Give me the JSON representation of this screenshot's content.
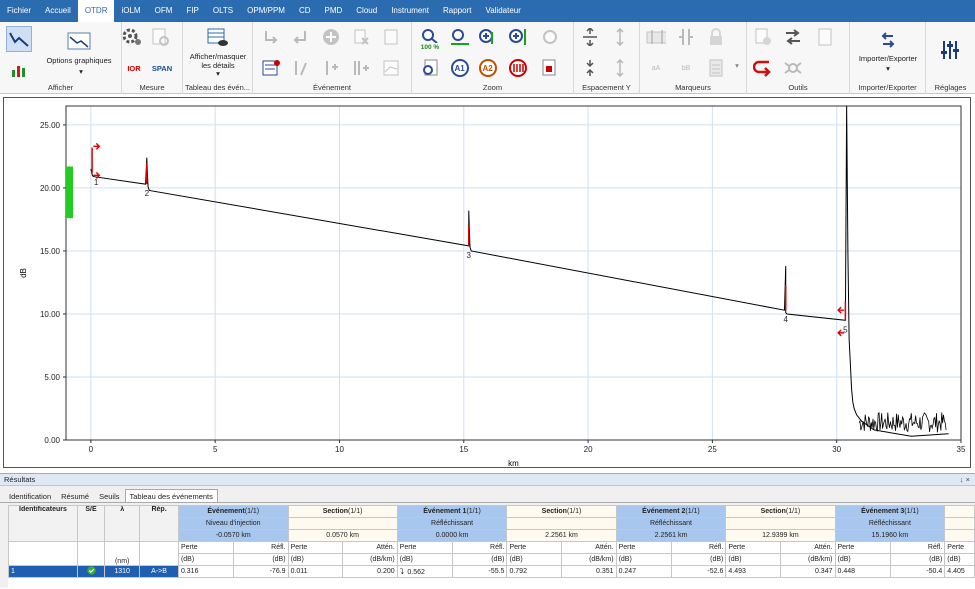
{
  "menu": [
    "Fichier",
    "Accueil",
    "OTDR",
    "iOLM",
    "OFM",
    "FIP",
    "OLTS",
    "OPM/PPM",
    "CD",
    "PMD",
    "Cloud",
    "Instrument",
    "Rapport",
    "Validateur"
  ],
  "ribbon": {
    "afficher": {
      "label": "Afficher",
      "options": "Options graphiques"
    },
    "mesure": {
      "label": "Mesure",
      "ior": "IOR",
      "span": "SPAN"
    },
    "tableau": {
      "label": "Tableau des évén...",
      "btn1": "Afficher/masquer",
      "btn2": "les détails"
    },
    "evenement": {
      "label": "Événement"
    },
    "zoom": {
      "label": "Zoom",
      "pct": "100 %",
      "a1": "A1",
      "a2": "A2"
    },
    "espacement": {
      "label": "Espacement Y"
    },
    "marqueurs": {
      "label": "Marqueurs",
      "a": "aA",
      "b": "bB"
    },
    "outils": {
      "label": "Outils"
    },
    "importer": {
      "label": "Importer/Exporter",
      "btn": "Importer/Exporter"
    },
    "reglages": {
      "label": "Réglages"
    }
  },
  "chart_data": {
    "type": "line",
    "xlabel": "km",
    "ylabel": "dB",
    "xlim": [
      -1,
      35
    ],
    "ylim": [
      0,
      26.5
    ],
    "xticks": [
      0,
      5,
      10,
      15,
      20,
      25,
      30,
      35
    ],
    "yticks": [
      "0.00",
      "5.00",
      "10.00",
      "15.00",
      "20.00",
      "25.00"
    ],
    "series": [
      {
        "x": [
          0,
          0.06,
          0.1,
          2.2,
          2.25,
          2.3,
          2.35,
          15.2,
          15.2,
          15.25,
          15.3,
          27.9,
          27.95,
          27.95,
          28.0,
          30.35,
          30.4,
          30.45,
          30.5,
          30.55,
          30.6,
          30.65,
          30.7,
          30.8,
          31.0,
          31.5,
          33,
          34.5
        ],
        "y": [
          21.5,
          21.0,
          20.9,
          20.3,
          22.4,
          20.1,
          19.8,
          15.4,
          18.2,
          15.3,
          15.0,
          10.3,
          13.8,
          10.1,
          10.0,
          9.5,
          26.5,
          15,
          8.0,
          6.0,
          4.0,
          3.0,
          2.5,
          2.0,
          1.5,
          0.8,
          0.3,
          0.5
        ]
      }
    ],
    "events": [
      "1",
      "2",
      "3",
      "4",
      "5"
    ],
    "grid": true
  },
  "results": {
    "title": "Résultats",
    "ctrl": "↓ ×",
    "tabs": [
      "Identification",
      "Résumé",
      "Seuils",
      "Tableau des événements"
    ],
    "headers": {
      "ident": "Identificateurs",
      "se": "S/E",
      "lambda": "λ",
      "rep": "Rép.",
      "ev": "Événement",
      "sec": "Section",
      "ev1": "Événement 1",
      "ev2": "Événement 2",
      "ev3": "Événement 3",
      "frac": "(1/1)"
    },
    "sub": {
      "niveau": "Niveau d'injection",
      "reflechissant": "Réfléchissant"
    },
    "dist": {
      "e0": "-0.0570 km",
      "s0": "0.0570 km",
      "e1": "0.0000 km",
      "s1": "2.2561 km",
      "e2": "2.2561 km",
      "s2": "12.9399 km",
      "e3": "15.1960 km"
    },
    "units": {
      "nm": "(nm)",
      "perte": "Perte",
      "refl": "Réfl.",
      "atten": "Attén.",
      "db": "(dB)",
      "dbkm": "(dB/km)"
    },
    "row": {
      "id": "1",
      "lambda": "1310",
      "rep": "A->B",
      "v": [
        "0.316",
        "-76.9",
        "0.011",
        "0.200",
        "0.562",
        "-55.5",
        "0.792",
        "0.351",
        "0.247",
        "-52.6",
        "4.493",
        "0.347",
        "0.448",
        "-50.4",
        "4.405"
      ]
    }
  },
  "colors": {
    "menu": "#2b6cb0",
    "selected": "#1f5fb2",
    "header": "#a8c7ee",
    "event": "#e00000",
    "launch": "#22cc22"
  }
}
